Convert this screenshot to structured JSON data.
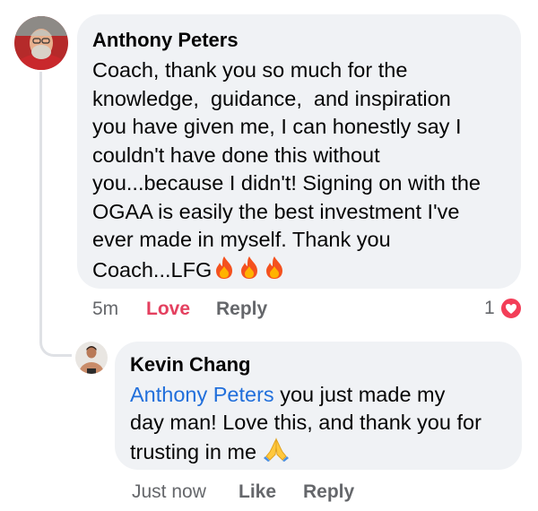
{
  "comment": {
    "author": "Anthony Peters",
    "lines": [
      "Coach, thank you so much for the",
      "knowledge,  guidance,  and inspiration",
      "you have given me, I can honestly say I",
      "couldn't have done this without",
      "you...because I didn't! Signing on with the",
      "OGAA is easily the best investment I've",
      "ever made in myself. Thank you"
    ],
    "last_line": "Coach...LFG",
    "emoji": "fire-icon",
    "timestamp": "5m",
    "love_label": "Love",
    "reply_label": "Reply",
    "reaction_count": "1"
  },
  "reply": {
    "author": "Kevin Chang",
    "mention": "Anthony Peters",
    "line1_rest": " you just made my",
    "line2": "day man! Love this, and thank you for",
    "line3": "trusting in me",
    "emoji": "pray-icon",
    "timestamp": "Just now",
    "like_label": "Like",
    "reply_label": "Reply"
  },
  "colors": {
    "bubble": "#f0f2f5",
    "love": "#e4405f",
    "mention": "#216fdb",
    "meta": "#65676b"
  }
}
